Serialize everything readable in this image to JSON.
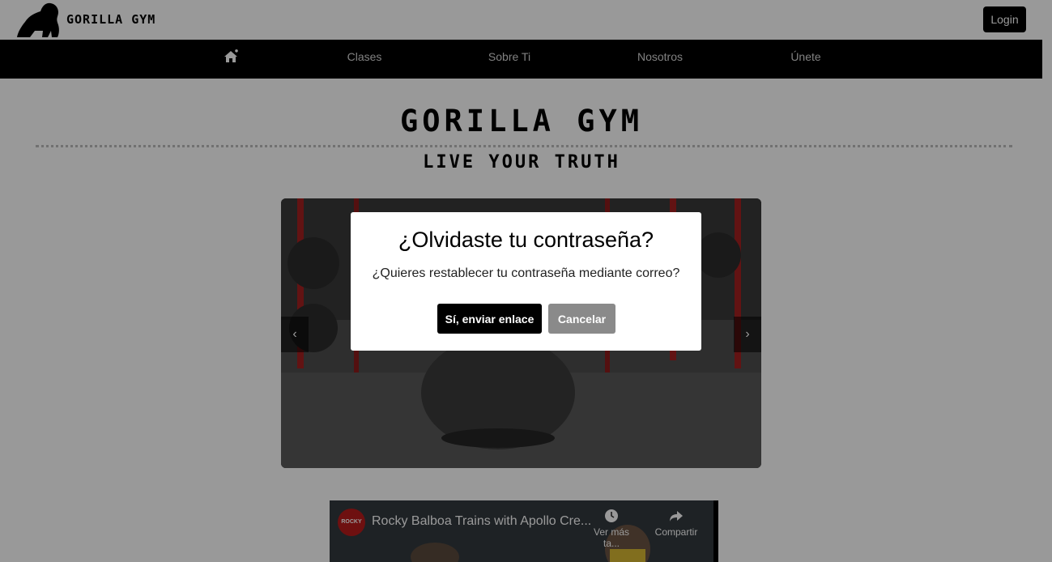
{
  "header": {
    "brand": "GORILLA GYM",
    "login_label": "Login",
    "logo_icon": "gorilla-logo-icon"
  },
  "nav": {
    "home_icon": "home-icon",
    "items": [
      {
        "label": "Clases"
      },
      {
        "label": "Sobre Ti"
      },
      {
        "label": "Nosotros"
      },
      {
        "label": "Únete"
      }
    ]
  },
  "hero": {
    "title": "GORILLA GYM",
    "subtitle": "LIVE YOUR TRUTH"
  },
  "carousel": {
    "prev_label": "‹",
    "next_label": "›",
    "image": "gorilla-kettlebell-gym-photo"
  },
  "video": {
    "channel_badge": "ROCKY",
    "title": "Rocky Balboa Trains with Apollo Cre...",
    "watch_later_label": "Ver más ta...",
    "share_label": "Compartir"
  },
  "modal": {
    "title": "¿Olvidaste tu contraseña?",
    "text": "¿Quieres restablecer tu contraseña mediante correo?",
    "confirm_label": "Sí, enviar enlace",
    "cancel_label": "Cancelar"
  }
}
